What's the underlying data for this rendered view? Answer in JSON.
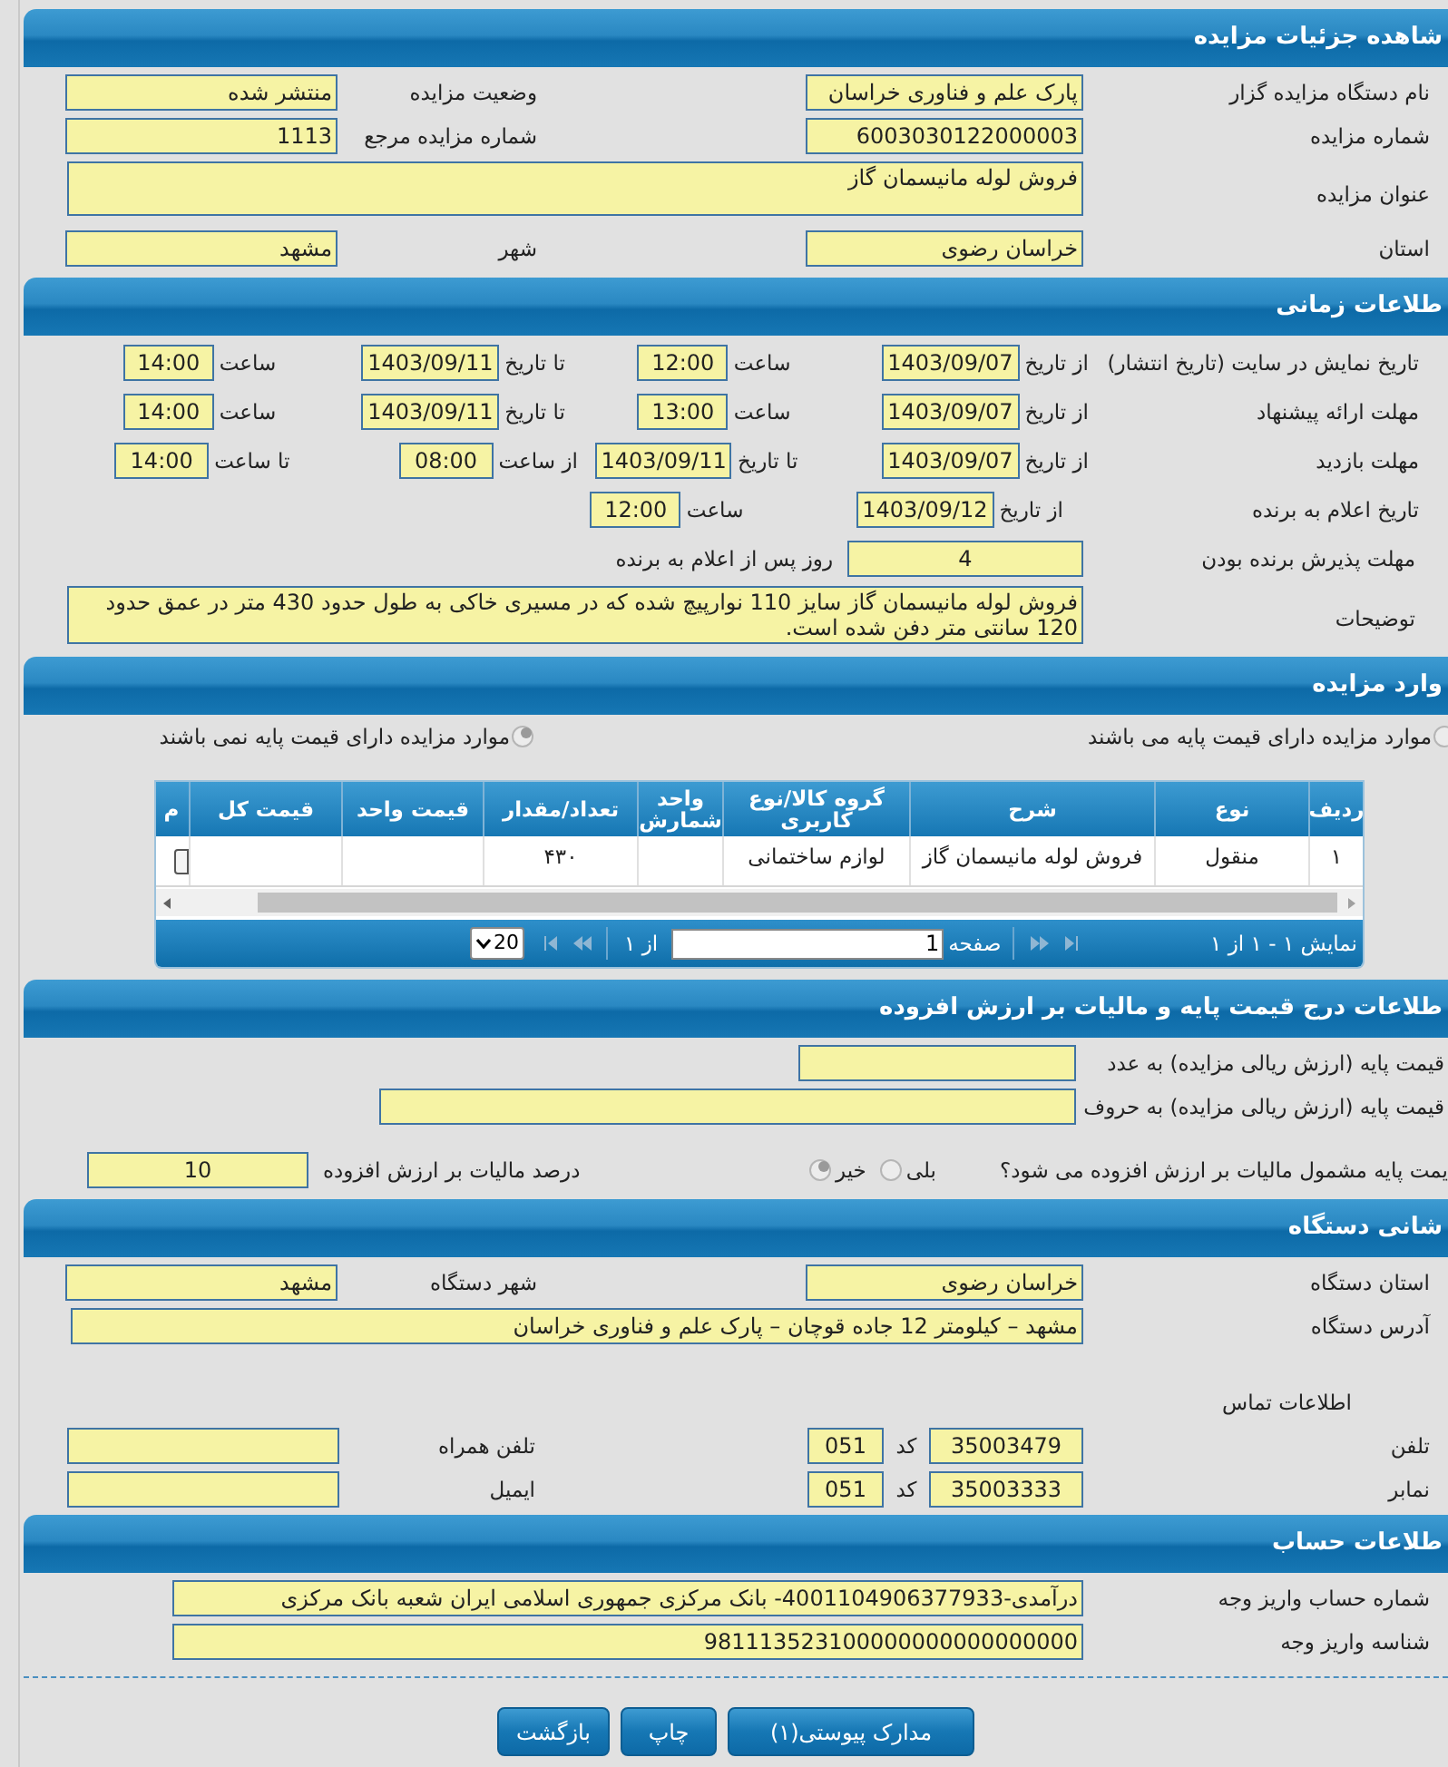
{
  "details": {
    "title": "شاهده جزئیات مزایده",
    "rows": [
      {
        "kind": "pair",
        "fields": [
          {
            "label": "نام دستگاه مزایده گزار",
            "value": "پارک علم و فناوری خراسان"
          },
          {
            "label": "وضعیت مزایده",
            "value": "منتشر شده"
          }
        ]
      },
      {
        "kind": "pair",
        "fields": [
          {
            "label": "شماره مزایده",
            "value": "6003030122000003"
          },
          {
            "label": "شماره مزایده مرجع",
            "value": "1113"
          }
        ]
      },
      {
        "kind": "textarea",
        "fields": [
          {
            "label": "عنوان مزایده",
            "value": "فروش لوله مانیسمان گاز"
          }
        ]
      },
      {
        "kind": "pair",
        "fields": [
          {
            "label": "استان",
            "value": "خراسان رضوی"
          },
          {
            "label": "شهر",
            "value": "مشهد"
          }
        ]
      }
    ]
  },
  "timing": {
    "title": "طلاعات زمانی",
    "rows": [
      {
        "kind": "range",
        "label": "تاریخ نمایش در سایت (تاریخ انتشار)",
        "fields": [
          {
            "prefix": "از تاریخ",
            "value": "1403/09/07"
          },
          {
            "prefix": "ساعت",
            "value": "12:00"
          },
          {
            "prefix": "تا تاریخ",
            "value": "1403/09/11"
          },
          {
            "prefix": "ساعت",
            "value": "14:00"
          }
        ]
      },
      {
        "kind": "range",
        "label": "مهلت ارائه پیشنهاد",
        "fields": [
          {
            "prefix": "از تاریخ",
            "value": "1403/09/07"
          },
          {
            "prefix": "ساعت",
            "value": "13:00"
          },
          {
            "prefix": "تا تاریخ",
            "value": "1403/09/11"
          },
          {
            "prefix": "ساعت",
            "value": "14:00"
          }
        ]
      },
      {
        "kind": "visit",
        "label": "مهلت بازدید",
        "fields": [
          {
            "prefix": "از تاریخ",
            "value": "1403/09/07"
          },
          {
            "prefix": "تا تاریخ",
            "value": "1403/09/11"
          },
          {
            "prefix": "از ساعت",
            "value": "08:00"
          },
          {
            "prefix": "تا ساعت",
            "value": "14:00"
          }
        ]
      },
      {
        "kind": "single",
        "label": "تاریخ اعلام به برنده",
        "fields": [
          {
            "prefix": "از تاریخ",
            "value": "1403/09/12"
          },
          {
            "prefix": "ساعت",
            "value": "12:00"
          }
        ]
      },
      {
        "kind": "days",
        "label": "مهلت پذیرش برنده بودن",
        "fields": [
          {
            "value": "4",
            "suffix": "روز پس از اعلام به برنده"
          }
        ]
      },
      {
        "kind": "textarea",
        "label": "توضیحات",
        "fields": [
          {
            "value": "فروش لوله مانیسمان گاز سایز 110 نوارپیچ شده که در مسیری خاکی به طول حدود 430 متر در عمق حدود 120 سانتی متر دفن شده است."
          }
        ]
      }
    ]
  },
  "items": {
    "title": "وارد مزایده",
    "base_price_options": [
      {
        "label": "موارد مزایده دارای قیمت پایه می باشند",
        "selected": false
      },
      {
        "label": "موارد مزایده دارای قیمت پایه نمی باشند",
        "selected": true
      }
    ],
    "table": {
      "columns": [
        "ردیف",
        "نوع",
        "شرح",
        "گروه کالا/نوع کاربری",
        "واحد شمارش",
        "تعداد/مقدار",
        "قیمت واحد",
        "قیمت کل",
        "م"
      ],
      "rows": [
        {
          "row_number": "۱",
          "type": "منقول",
          "description": "فروش لوله مانیسمان گاز",
          "group": "لوازم ساختمانی",
          "quantity": "۴۳۰"
        }
      ]
    },
    "pager": {
      "summary": "نمایش ۱ - ۱ از ۱",
      "page_label": "صفحه",
      "page": "1",
      "of": "از ۱",
      "page_size": "20"
    }
  },
  "pricing": {
    "title": "طلاعات درج قیمت پایه و مالیات بر ارزش افزوده",
    "fields": [
      {
        "label": "قیمت پایه (ارزش ریالی مزایده) به عدد"
      },
      {
        "label": "قیمت پایه (ارزش ریالی مزایده) به حروف"
      }
    ],
    "vat_question": "یمت پایه مشمول مالیات بر ارزش افزوده می شود؟",
    "vat_options": [
      {
        "label": "بلی",
        "selected": false
      },
      {
        "label": "خیر",
        "selected": true
      }
    ],
    "vat_percent": {
      "label": "درصد مالیات بر ارزش افزوده",
      "value": "10"
    }
  },
  "address": {
    "title": "شانی دستگاه",
    "rows": [
      {
        "kind": "pair",
        "fields": [
          {
            "label": "استان دستگاه",
            "value": "خراسان رضوی"
          },
          {
            "label": "شهر دستگاه",
            "value": "مشهد"
          }
        ]
      }
    ],
    "address_line": {
      "label": "آدرس دستگاه",
      "value": "مشهد – کیلومتر 12 جاده قوچان – پارک علم و فناوری خراسان"
    },
    "contact_heading": "اطلاعات تماس",
    "contacts": [
      {
        "label": "تلفن",
        "number": "35003479",
        "code_label": "کد",
        "code": "051",
        "other_label": "تلفن همراه"
      },
      {
        "label": "نمابر",
        "number": "35003333",
        "code_label": "کد",
        "code": "051",
        "other_label": "ایمیل"
      }
    ]
  },
  "account": {
    "title": "طلاعات حساب",
    "fields": [
      {
        "label": "شماره حساب واریز وجه",
        "value": "درآمدی-4001104906377933- بانک مرکزی جمهوری اسلامی ایران شعبه بانک مرکزی"
      },
      {
        "label": "شناسه واریز وجه",
        "value": "981113523100000000000000000"
      }
    ]
  },
  "buttons": [
    "مدارک پیوستی(۱)",
    "چاپ",
    "بازگشت"
  ]
}
